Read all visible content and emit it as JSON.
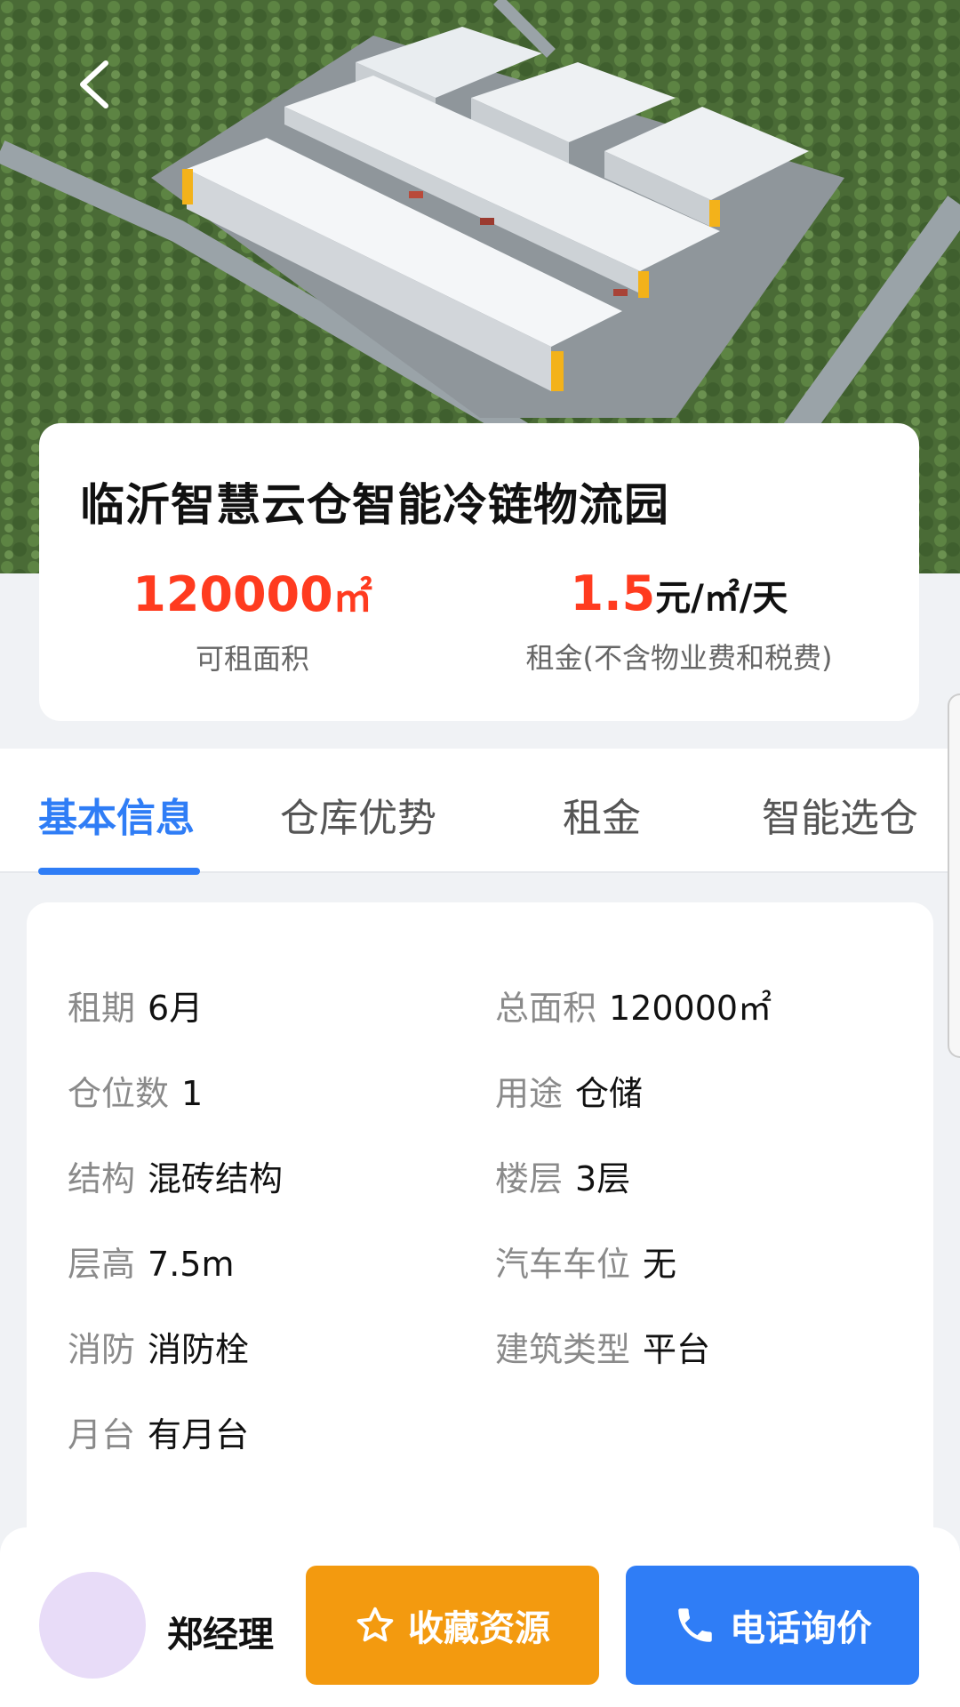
{
  "header": {
    "back_icon": "chevron-left-icon"
  },
  "park": {
    "title": "临沂智慧云仓智能冷链物流园",
    "area_value": "120000",
    "area_unit": "㎡",
    "area_caption": "可租面积",
    "rent_value": "1.5",
    "rent_unit": "元/㎡/天",
    "rent_caption": "租金(不含物业费和税费)"
  },
  "tabs": [
    {
      "label": "基本信息",
      "active": true
    },
    {
      "label": "仓库优势",
      "active": false
    },
    {
      "label": "租金",
      "active": false
    },
    {
      "label": "智能选仓",
      "active": false
    }
  ],
  "info": {
    "left": [
      {
        "label": "租期",
        "value": "6月"
      },
      {
        "label": "仓位数",
        "value": "1"
      },
      {
        "label": "结构",
        "value": "混砖结构"
      },
      {
        "label": "层高",
        "value": "7.5m"
      },
      {
        "label": "消防",
        "value": "消防栓"
      },
      {
        "label": "月台",
        "value": "有月台"
      }
    ],
    "right": [
      {
        "label": "总面积",
        "value": "120000㎡"
      },
      {
        "label": "用途",
        "value": "仓储"
      },
      {
        "label": "楼层",
        "value": "3层"
      },
      {
        "label": "汽车车位",
        "value": "无"
      },
      {
        "label": "建筑类型",
        "value": "平台"
      }
    ]
  },
  "footer": {
    "agent_name": "郑经理",
    "favorite_label": "收藏资源",
    "favorite_icon": "star-icon",
    "call_label": "电话询价",
    "call_icon": "phone-icon"
  },
  "colors": {
    "accent_blue": "#2f7df6",
    "price_red": "#ff3b1f",
    "favorite_orange": "#f39a0f"
  }
}
